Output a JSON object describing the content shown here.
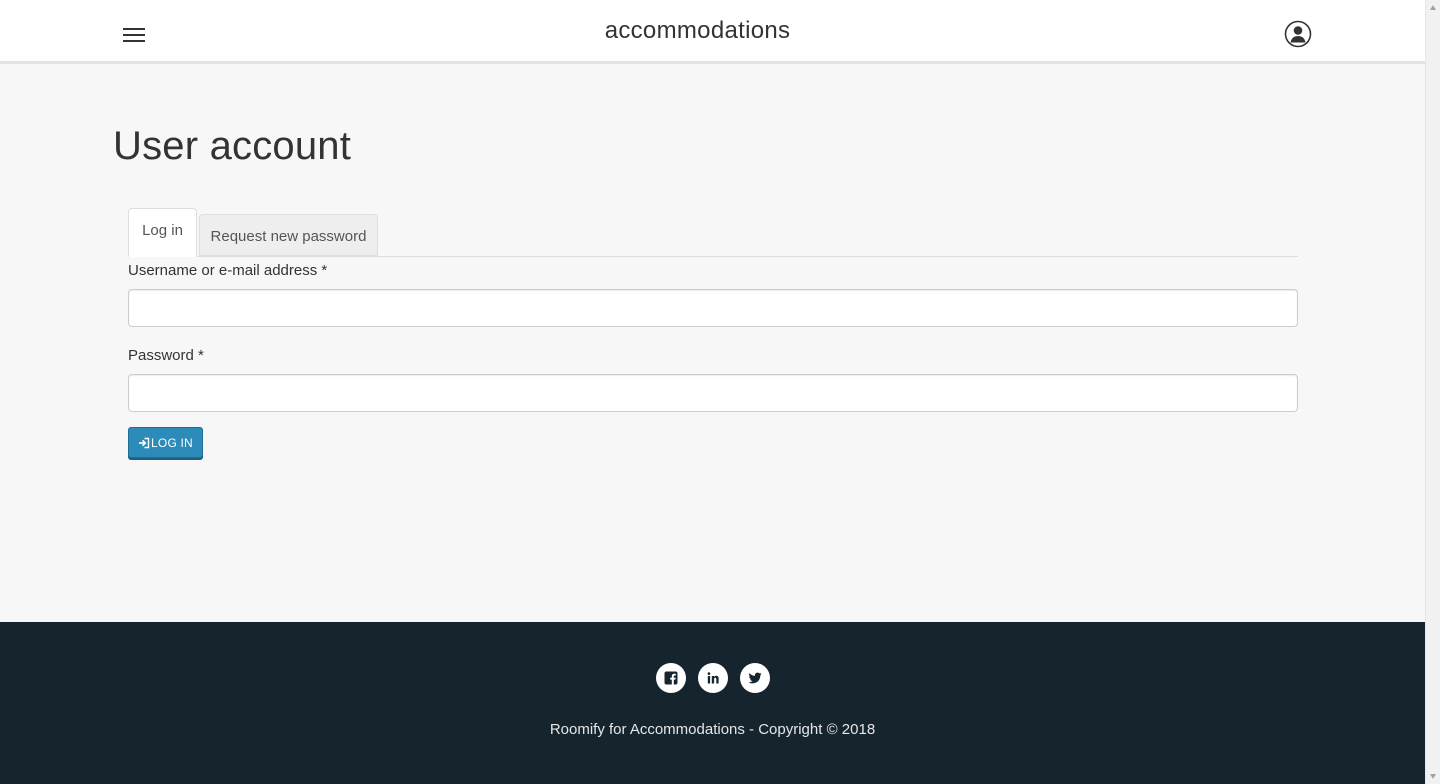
{
  "header": {
    "site_title": "accommodations",
    "menu_icon": "hamburger-menu-icon",
    "account_icon": "user-account-icon"
  },
  "main": {
    "page_title": "User account",
    "tabs": [
      {
        "label": "Log in",
        "active": true
      },
      {
        "label": "Request new password",
        "active": false
      }
    ],
    "form": {
      "username_label": "Username or e-mail address",
      "username_value": "",
      "password_label": "Password",
      "password_value": "",
      "required_marker": "*",
      "submit_label": "LOG IN",
      "submit_icon": "log-in-icon"
    }
  },
  "footer": {
    "social_icons": [
      "facebook-icon",
      "linkedin-icon",
      "twitter-icon"
    ],
    "copyright": "Roomify for Accommodations - Copyright © 2018"
  },
  "colors": {
    "primary_button": "#2c8bb8",
    "footer_background": "#16252d",
    "page_background": "#f7f7f7"
  }
}
